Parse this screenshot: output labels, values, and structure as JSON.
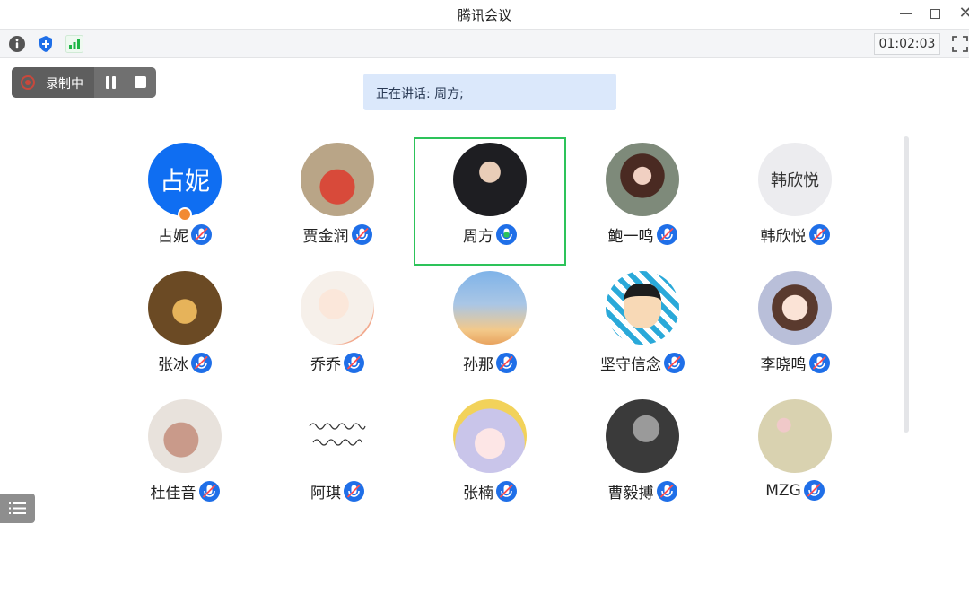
{
  "window": {
    "title": "腾讯会议"
  },
  "toolbar": {
    "timer": "01:02:03"
  },
  "recording": {
    "label": "录制中"
  },
  "speaking": {
    "text": "正在讲话: 周方;"
  },
  "participants": [
    {
      "name": "占妮",
      "avatar_text": "占妮",
      "mic": "muted",
      "host": true
    },
    {
      "name": "贾金润",
      "mic": "muted"
    },
    {
      "name": "周方",
      "mic": "speaking",
      "active": true
    },
    {
      "name": "鲍一鸣",
      "mic": "muted"
    },
    {
      "name": "韩欣悦",
      "avatar_text": "韩欣悦",
      "mic": "muted"
    },
    {
      "name": "张冰",
      "mic": "muted"
    },
    {
      "name": "乔乔",
      "mic": "muted"
    },
    {
      "name": "孙那",
      "mic": "muted"
    },
    {
      "name": "坚守信念",
      "mic": "muted"
    },
    {
      "name": "李晓鸣",
      "mic": "muted"
    },
    {
      "name": "杜佳音",
      "mic": "muted"
    },
    {
      "name": "阿琪",
      "mic": "muted"
    },
    {
      "name": "张楠",
      "mic": "muted"
    },
    {
      "name": "曹毅搏",
      "mic": "muted"
    },
    {
      "name": "MZG",
      "mic": "muted"
    }
  ],
  "colors": {
    "accent": "#1f6fe8",
    "active_border": "#2dc35a",
    "speaking_bg": "#dbe8fb"
  }
}
